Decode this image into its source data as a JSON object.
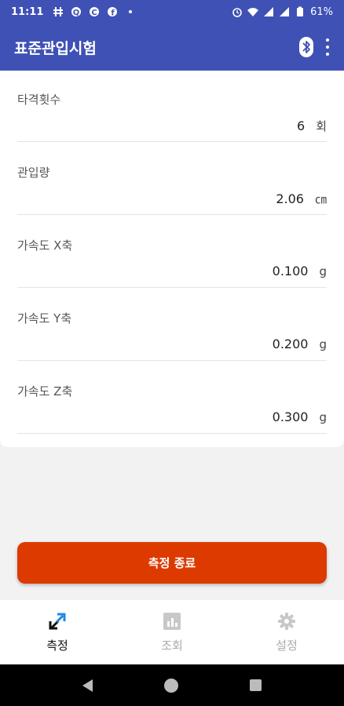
{
  "status": {
    "time": "11:11",
    "battery": "61%",
    "left_icons": [
      "hash-icon",
      "q-icon",
      "c-icon",
      "facebook-icon",
      "dot-icon"
    ],
    "right_icons": [
      "alarm-icon",
      "wifi-icon",
      "signal-icon",
      "signal-icon",
      "battery-icon"
    ]
  },
  "appbar": {
    "title": "표준관입시험",
    "icons": [
      "bluetooth-icon",
      "more-vert-icon"
    ]
  },
  "fields": [
    {
      "label": "타격횟수",
      "value": "6",
      "unit": "회"
    },
    {
      "label": "관입량",
      "value": "2.06",
      "unit": "㎝"
    },
    {
      "label": "가속도 X축",
      "value": "0.100",
      "unit": "g"
    },
    {
      "label": "가속도 Y축",
      "value": "0.200",
      "unit": "g"
    },
    {
      "label": "가속도 Z축",
      "value": "0.300",
      "unit": "g"
    }
  ],
  "end_button": {
    "label": "측정 종료",
    "color": "#dd3a00"
  },
  "bottom_nav": {
    "items": [
      {
        "label": "측정",
        "icon": "measure-icon",
        "active": true
      },
      {
        "label": "조회",
        "icon": "chart-icon",
        "active": false
      },
      {
        "label": "설정",
        "icon": "gear-icon",
        "active": false
      }
    ]
  },
  "colors": {
    "primary": "#3f51b5",
    "accent": "#1e88e5",
    "danger": "#dd3a00"
  }
}
